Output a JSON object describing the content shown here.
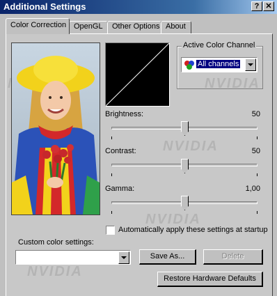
{
  "window": {
    "title": "Additional Settings",
    "help_label": "?",
    "close_label": "✕"
  },
  "tabs": [
    {
      "label": "Color Correction",
      "active": true
    },
    {
      "label": "OpenGL",
      "active": false
    },
    {
      "label": "Other Options",
      "active": false
    },
    {
      "label": "About",
      "active": false
    }
  ],
  "watermark": "NVIDIA",
  "channel_group": {
    "label": "Active Color Channel",
    "selected": "All channels"
  },
  "sliders": {
    "brightness": {
      "label": "Brightness:",
      "value": "50",
      "level": 0.5
    },
    "contrast": {
      "label": "Contrast:",
      "value": "50",
      "level": 0.5
    },
    "gamma": {
      "label": "Gamma:",
      "value": "1,00",
      "level": 0.5
    }
  },
  "auto_apply": {
    "label": "Automatically apply these settings at startup",
    "checked": false
  },
  "custom": {
    "label": "Custom color settings:",
    "value": "",
    "save_as": "Save As...",
    "delete": "Delete"
  },
  "restore_label": "Restore Hardware Defaults",
  "colors": {
    "title_start": "#0a246a",
    "title_end": "#a6caf0",
    "selection": "#000080"
  }
}
